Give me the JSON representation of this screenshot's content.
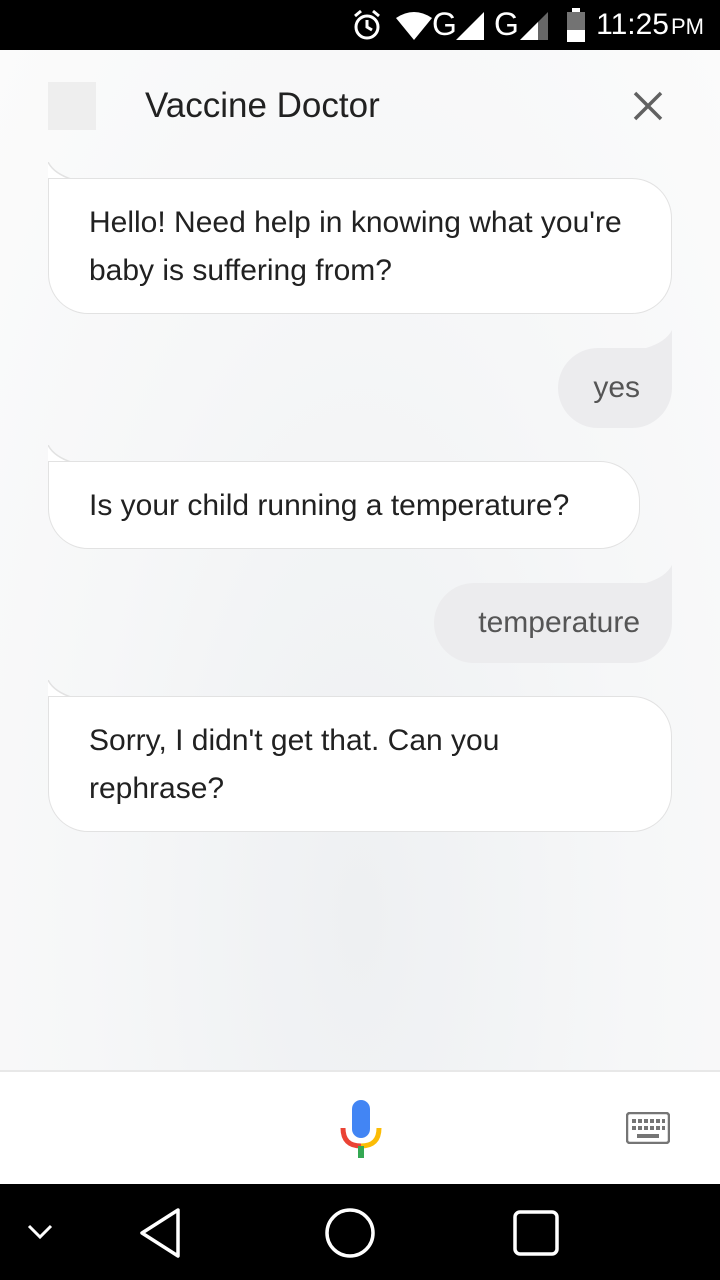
{
  "status_bar": {
    "time": "11:25",
    "ampm": "PM",
    "network_1": "G",
    "network_2": "G",
    "icons": [
      "alarm-icon",
      "wifi-icon",
      "signal-icon",
      "signal-icon",
      "battery-icon"
    ]
  },
  "header": {
    "title": "Vaccine Doctor",
    "close_icon": "close-icon"
  },
  "messages": [
    {
      "sender": "bot",
      "text": "Hello! Need help in knowing what you're baby is suffering from?"
    },
    {
      "sender": "user",
      "text": "yes"
    },
    {
      "sender": "bot",
      "text": "Is your child running a temperature?"
    },
    {
      "sender": "user",
      "text": "temperature"
    },
    {
      "sender": "bot",
      "text": "Sorry, I didn't get that. Can you rephrase?"
    }
  ],
  "input_bar": {
    "mic_icon": "mic-icon",
    "keyboard_icon": "keyboard-icon"
  },
  "nav_bar": {
    "icons": [
      "chevron-down-icon",
      "back-icon",
      "home-icon",
      "recents-icon"
    ]
  },
  "colors": {
    "mic_blue": "#4285F4",
    "mic_red": "#EA4335",
    "mic_yellow": "#FBBC05",
    "mic_green": "#34A853"
  }
}
